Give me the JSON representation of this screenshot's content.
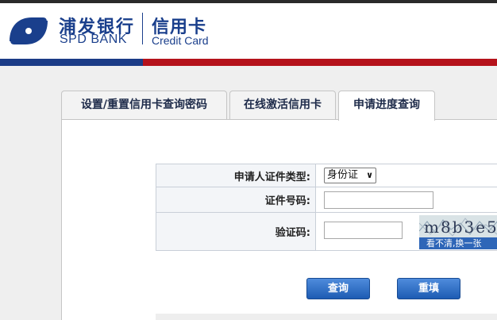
{
  "header": {
    "bank_name_cn": "浦发银行",
    "bank_name_en": "SPD BANK",
    "product_cn": "信用卡",
    "product_en": "Credit Card"
  },
  "tabs": [
    {
      "label": "设置/重置信用卡查询密码",
      "active": false
    },
    {
      "label": "在线激活信用卡",
      "active": false
    },
    {
      "label": "申请进度查询",
      "active": true
    }
  ],
  "form": {
    "id_type_label": "申请人证件类型:",
    "id_type_value": "身份证",
    "id_number_label": "证件号码:",
    "id_number_value": "",
    "captcha_label": "验证码:",
    "captcha_value": "",
    "captcha_image_text": "m8b3e5",
    "captcha_refresh_label": "看不清,换一张"
  },
  "buttons": {
    "query_label": "查询",
    "reset_label": "重填"
  },
  "colors": {
    "brand_blue": "#1b3b86",
    "brand_red": "#b5121b",
    "button_blue": "#1d5bb3"
  }
}
